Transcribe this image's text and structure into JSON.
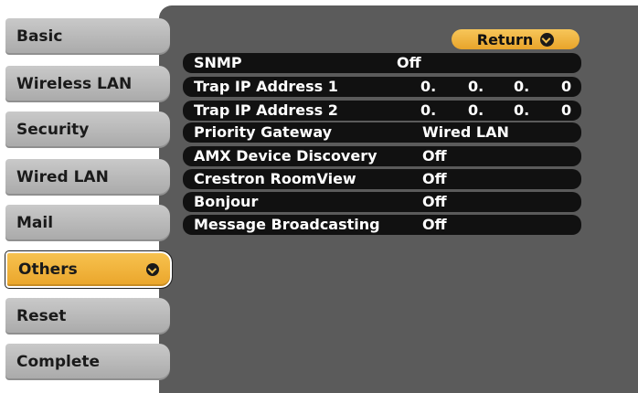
{
  "sidebar": {
    "items": [
      {
        "label": "Basic"
      },
      {
        "label": "Wireless LAN"
      },
      {
        "label": "Security"
      },
      {
        "label": "Wired LAN"
      },
      {
        "label": "Mail"
      },
      {
        "label": "Others",
        "selected": true
      },
      {
        "label": "Reset"
      },
      {
        "label": "Complete"
      }
    ],
    "selected_icon": "enter-icon"
  },
  "return_button": {
    "label": "Return",
    "icon": "enter-icon"
  },
  "settings": {
    "snmp": {
      "name": "SNMP",
      "value": "Off"
    },
    "trap1": {
      "name": "Trap IP Address 1",
      "octets": [
        "0.",
        "0.",
        "0.",
        "0"
      ]
    },
    "trap2": {
      "name": "Trap IP Address 2",
      "octets": [
        "0.",
        "0.",
        "0.",
        "0"
      ]
    },
    "priority_gateway": {
      "name": "Priority Gateway",
      "value": "Wired LAN"
    },
    "amx": {
      "name": "AMX Device Discovery",
      "value": "Off"
    },
    "crestron": {
      "name": "Crestron RoomView",
      "value": "Off"
    },
    "bonjour": {
      "name": "Bonjour",
      "value": "Off"
    },
    "message_broadcasting": {
      "name": "Message Broadcasting",
      "value": "Off"
    }
  },
  "colors": {
    "panel": "#5b5b5b",
    "row": "#111111",
    "menu": "#bdbdbd",
    "accent": "#f0b23c"
  }
}
